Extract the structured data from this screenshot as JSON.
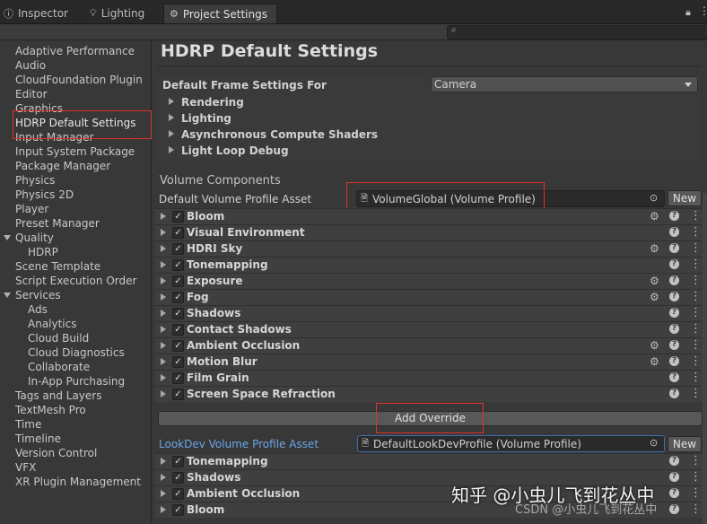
{
  "tabs": [
    {
      "label": "Inspector",
      "icon": "info-icon"
    },
    {
      "label": "Lighting",
      "icon": "lightbulb-icon"
    },
    {
      "label": "Project Settings",
      "icon": "gear-icon"
    }
  ],
  "sidebar": {
    "items": [
      {
        "label": "Adaptive Performance"
      },
      {
        "label": "Audio"
      },
      {
        "label": "CloudFoundation Plugin"
      },
      {
        "label": "Editor"
      },
      {
        "label": "Graphics"
      },
      {
        "label": "HDRP Default Settings"
      },
      {
        "label": "Input Manager"
      },
      {
        "label": "Input System Package"
      },
      {
        "label": "Package Manager"
      },
      {
        "label": "Physics"
      },
      {
        "label": "Physics 2D"
      },
      {
        "label": "Player"
      },
      {
        "label": "Preset Manager"
      },
      {
        "label": "Quality"
      },
      {
        "label": "HDRP"
      },
      {
        "label": "Scene Template"
      },
      {
        "label": "Script Execution Order"
      },
      {
        "label": "Services"
      },
      {
        "label": "Ads"
      },
      {
        "label": "Analytics"
      },
      {
        "label": "Cloud Build"
      },
      {
        "label": "Cloud Diagnostics"
      },
      {
        "label": "Collaborate"
      },
      {
        "label": "In-App Purchasing"
      },
      {
        "label": "Tags and Layers"
      },
      {
        "label": "TextMesh Pro"
      },
      {
        "label": "Time"
      },
      {
        "label": "Timeline"
      },
      {
        "label": "Version Control"
      },
      {
        "label": "VFX"
      },
      {
        "label": "XR Plugin Management"
      }
    ]
  },
  "main": {
    "title": "HDRP Default Settings",
    "frame_settings_label": "Default Frame Settings For",
    "frame_settings_value": "Camera",
    "frame_sections": [
      "Rendering",
      "Lighting",
      "Asynchronous Compute Shaders",
      "Light Loop Debug"
    ],
    "volume_components_header": "Volume Components",
    "default_volume_label": "Default Volume Profile Asset",
    "default_volume_value": "VolumeGlobal (Volume Profile)",
    "new_label": "New",
    "overrides": [
      {
        "name": "Bloom",
        "gear": true
      },
      {
        "name": "Visual Environment",
        "gear": false
      },
      {
        "name": "HDRI Sky",
        "gear": true
      },
      {
        "name": "Tonemapping",
        "gear": false
      },
      {
        "name": "Exposure",
        "gear": true
      },
      {
        "name": "Fog",
        "gear": true
      },
      {
        "name": "Shadows",
        "gear": false
      },
      {
        "name": "Contact Shadows",
        "gear": false
      },
      {
        "name": "Ambient Occlusion",
        "gear": true
      },
      {
        "name": "Motion Blur",
        "gear": true
      },
      {
        "name": "Film Grain",
        "gear": false
      },
      {
        "name": "Screen Space Refraction",
        "gear": false
      }
    ],
    "add_override_label": "Add Override",
    "lookdev_label": "LookDev Volume Profile Asset",
    "lookdev_value": "DefaultLookDevProfile (Volume Profile)",
    "lookdev_overrides": [
      {
        "name": "Tonemapping"
      },
      {
        "name": "Shadows"
      },
      {
        "name": "Ambient Occlusion"
      },
      {
        "name": "Bloom"
      }
    ]
  },
  "watermark": {
    "text1": "知乎 @小虫儿飞到花丛中",
    "text2": "CSDN @小虫儿飞到花丛中"
  }
}
